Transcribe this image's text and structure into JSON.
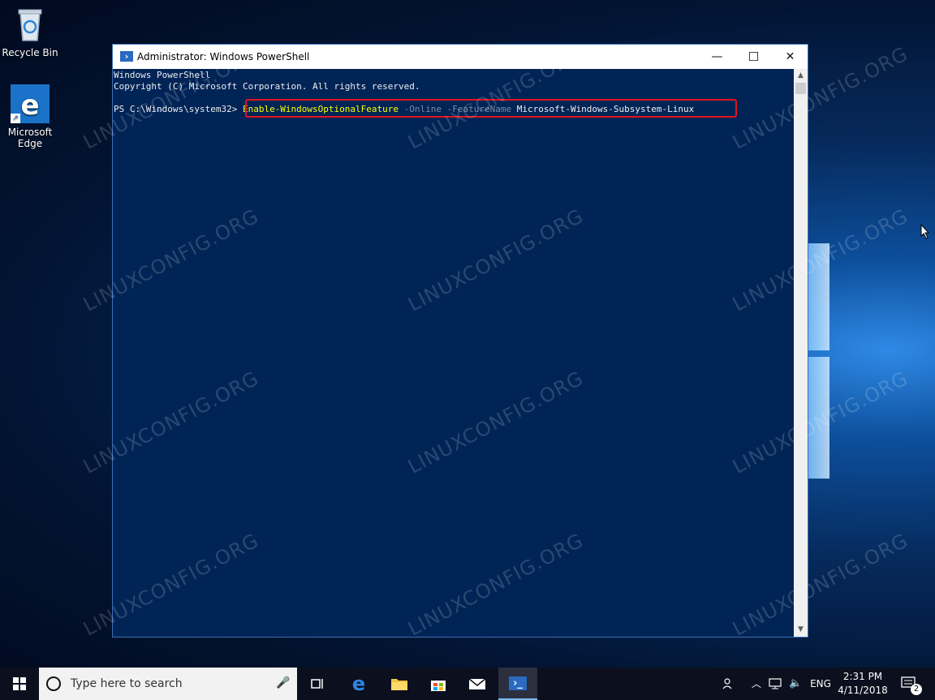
{
  "desktop": {
    "icons": [
      {
        "label": "Recycle Bin",
        "icon": "recycle-bin-icon"
      },
      {
        "label": "Microsoft Edge",
        "label_line1": "Microsoft",
        "label_line2": "Edge",
        "icon": "edge-icon"
      }
    ],
    "watermark": "LINUXCONFIG.ORG"
  },
  "window": {
    "title": "Administrator: Windows PowerShell",
    "minimize": "—",
    "maximize": "☐",
    "close": "✕",
    "console": {
      "line1": "Windows PowerShell",
      "line2": "Copyright (C) Microsoft Corporation. All rights reserved.",
      "prompt": "PS C:\\Windows\\system32> ",
      "command": "Enable-WindowsOptionalFeature",
      "param1": " -Online",
      "param2": " -FeatureName",
      "arg": " Microsoft-Windows-Subsystem-Linux"
    },
    "colors": {
      "console_bg": "#012456",
      "highlight_border": "#e0141e",
      "command": "#ffff00"
    }
  },
  "taskbar": {
    "search_placeholder": "Type here to search",
    "apps": [
      "task-view-icon",
      "edge-icon",
      "file-explorer-icon",
      "store-icon",
      "mail-icon",
      "powershell-icon"
    ],
    "tray": {
      "language": "ENG",
      "time": "2:31 PM",
      "date": "4/11/2018",
      "notification_count": "2"
    }
  }
}
